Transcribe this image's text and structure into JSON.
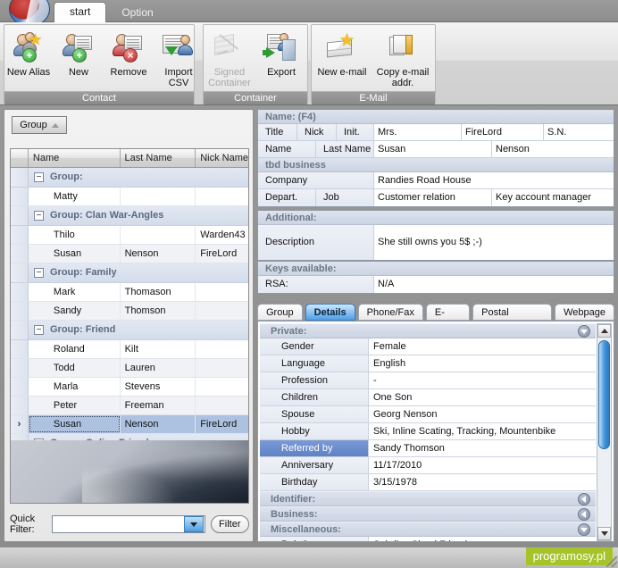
{
  "window": {
    "tabs": [
      {
        "label": "start",
        "active": true
      },
      {
        "label": "Option",
        "active": false
      }
    ]
  },
  "ribbon": {
    "groups": [
      {
        "title": "Contact",
        "buttons": [
          {
            "label": "New Alias",
            "icon": "person-star-add-icon",
            "disabled": false
          },
          {
            "label": "New",
            "icon": "person-card-add-icon",
            "disabled": false
          },
          {
            "label": "Remove",
            "icon": "person-card-remove-icon",
            "disabled": false
          },
          {
            "label": "Import CSV",
            "icon": "import-csv-icon",
            "disabled": false
          }
        ]
      },
      {
        "title": "Container",
        "buttons": [
          {
            "label": "Signed Container",
            "icon": "signed-container-icon",
            "disabled": true
          },
          {
            "label": "Export",
            "icon": "export-container-icon",
            "disabled": false
          }
        ]
      },
      {
        "title": "E-Mail",
        "buttons": [
          {
            "label": "New e-mail",
            "icon": "new-email-icon",
            "disabled": false
          },
          {
            "label": "Copy e-mail addr.",
            "icon": "copy-email-address-icon",
            "disabled": false
          }
        ]
      }
    ]
  },
  "left_panel": {
    "group_button": "Group",
    "sort_direction": "ascending",
    "columns": [
      "",
      "Name",
      "Last Name",
      "Nick Name"
    ],
    "rows": [
      {
        "type": "group",
        "label": "Group:",
        "expanded": true
      },
      {
        "type": "item",
        "marker": "",
        "name": "Matty",
        "last": "",
        "nick": "",
        "selected": false
      },
      {
        "type": "group",
        "label": "Group: Clan War-Angles",
        "expanded": true
      },
      {
        "type": "item",
        "marker": "",
        "name": "Thilo",
        "last": "",
        "nick": "Warden43",
        "selected": false
      },
      {
        "type": "item",
        "marker": "",
        "name": "Susan",
        "last": "Nenson",
        "nick": "FireLord",
        "selected": false
      },
      {
        "type": "group",
        "label": "Group: Family",
        "expanded": true
      },
      {
        "type": "item",
        "marker": "",
        "name": "Mark",
        "last": "Thomason",
        "nick": "",
        "selected": false
      },
      {
        "type": "item",
        "marker": "",
        "name": "Sandy",
        "last": "Thomson",
        "nick": "",
        "selected": false
      },
      {
        "type": "group",
        "label": "Group: Friend",
        "expanded": true
      },
      {
        "type": "item",
        "marker": "",
        "name": "Roland",
        "last": "Kilt",
        "nick": "",
        "selected": false
      },
      {
        "type": "item",
        "marker": "",
        "name": "Todd",
        "last": "Lauren",
        "nick": "",
        "selected": false
      },
      {
        "type": "item",
        "marker": "",
        "name": "Marla",
        "last": "Stevens",
        "nick": "",
        "selected": false
      },
      {
        "type": "item",
        "marker": "",
        "name": "Peter",
        "last": "Freeman",
        "nick": "",
        "selected": false
      },
      {
        "type": "item",
        "marker": "›",
        "name": "Susan",
        "last": "Nenson",
        "nick": "FireLord",
        "selected": true
      },
      {
        "type": "group",
        "label": "Group: Online Friend",
        "expanded": false
      }
    ],
    "quick_filter": {
      "label": "Quick Filter:",
      "value": "",
      "placeholder": "",
      "button": "Filter"
    }
  },
  "right_panel": {
    "name_section": {
      "header": "Name: (F4)",
      "row1": {
        "label_title": "Title",
        "label_nick": "Nick",
        "label_init": "Init.",
        "value_title": "Mrs.",
        "value_nick": "FireLord",
        "value_init": "S.N."
      },
      "row2": {
        "label_name": "Name",
        "label_last": "Last Name",
        "value_name": "Susan",
        "value_last": "Nenson"
      },
      "business_header": "tbd business",
      "row3": {
        "label_company": "Company",
        "value_company": "Randies Road House"
      },
      "row4": {
        "label_depart": "Depart.",
        "label_job": "Job",
        "value_depart": "Customer relation",
        "value_job": "Key account manager"
      }
    },
    "additional": {
      "header": "Additional:",
      "label_description": "Description",
      "value_description": "She still owns you 5$ ;-)"
    },
    "keys": {
      "header": "Keys available:",
      "label_rsa": "RSA:",
      "value_rsa": "N/A"
    },
    "tabs": [
      {
        "label": "Group",
        "active": false
      },
      {
        "label": "Details",
        "active": true
      },
      {
        "label": "Phone/Fax",
        "active": false
      },
      {
        "label": "E-Mail",
        "active": false
      },
      {
        "label": "Postal Address",
        "active": false
      },
      {
        "label": "Webpage",
        "active": false
      }
    ],
    "details": {
      "sections": [
        {
          "title": "Private:",
          "state": "expanded",
          "chevron": "down",
          "fields": [
            {
              "key": "Gender",
              "value": "Female",
              "selected": false
            },
            {
              "key": "Language",
              "value": "English",
              "selected": false
            },
            {
              "key": "Profession",
              "value": "-",
              "selected": false
            },
            {
              "key": "Children",
              "value": "One Son",
              "selected": false
            },
            {
              "key": "Spouse",
              "value": "Georg Nenson",
              "selected": false
            },
            {
              "key": "Hobby",
              "value": "Ski, Inline Scating, Tracking, Mountenbike",
              "selected": false
            },
            {
              "key": "Referred by",
              "value": "Sandy Thomson",
              "selected": true
            },
            {
              "key": "Anniversary",
              "value": "11/17/2010",
              "selected": false
            },
            {
              "key": "Birthday",
              "value": "3/15/1978",
              "selected": false
            }
          ]
        },
        {
          "title": "Identifier:",
          "state": "collapsed",
          "chevron": "left",
          "fields": []
        },
        {
          "title": "Business:",
          "state": "collapsed",
          "chevron": "left",
          "fields": []
        },
        {
          "title": "Miscellaneous:",
          "state": "expanded",
          "chevron": "down",
          "fields": [
            {
              "key": "Relation",
              "value": "Sabdies Shool Friend",
              "selected": false
            }
          ]
        }
      ]
    }
  },
  "status_bar": {
    "watermark": "programosy.pl"
  },
  "colors": {
    "accent_blue": "#4ea0e8",
    "selection_blue": "#adc2e0",
    "section_header": "#ccd4e2",
    "section_text": "#6b7786",
    "watermark_green": "#a6c42a"
  }
}
